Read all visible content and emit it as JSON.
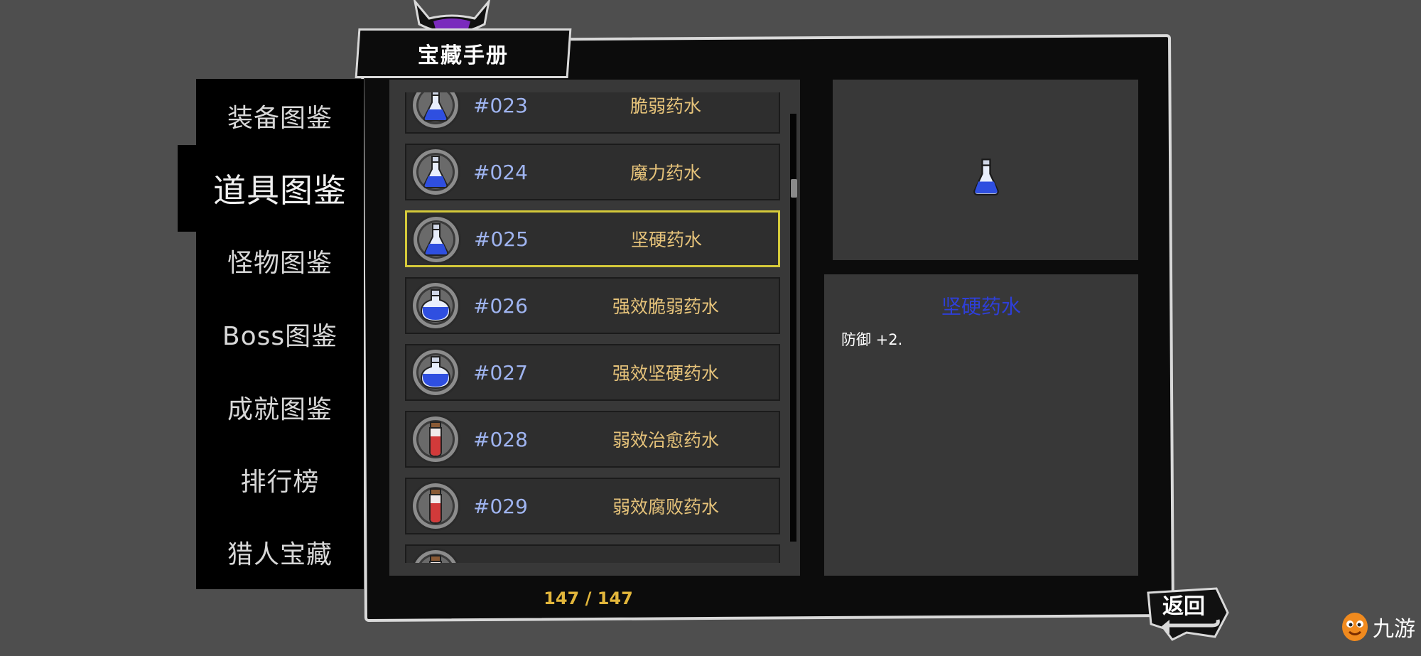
{
  "title": "宝藏手册",
  "nav": {
    "items": [
      {
        "label": "装备图鉴",
        "active": false
      },
      {
        "label": "道具图鉴",
        "active": true
      },
      {
        "label": "怪物图鉴",
        "active": false
      },
      {
        "label": "Boss图鉴",
        "active": false
      },
      {
        "label": "成就图鉴",
        "active": false
      },
      {
        "label": "排行榜",
        "active": false
      },
      {
        "label": "猎人宝藏",
        "active": false
      }
    ]
  },
  "list": {
    "items": [
      {
        "number": "#023",
        "name": "脆弱药水",
        "icon": "blue-flask-icon",
        "selected": false
      },
      {
        "number": "#024",
        "name": "魔力药水",
        "icon": "blue-flask-icon",
        "selected": false
      },
      {
        "number": "#025",
        "name": "坚硬药水",
        "icon": "blue-flask-icon",
        "selected": true
      },
      {
        "number": "#026",
        "name": "强效脆弱药水",
        "icon": "blue-bottle-icon",
        "selected": false
      },
      {
        "number": "#027",
        "name": "强效坚硬药水",
        "icon": "blue-bottle-icon",
        "selected": false
      },
      {
        "number": "#028",
        "name": "弱效治愈药水",
        "icon": "red-vial-icon",
        "selected": false
      },
      {
        "number": "#029",
        "name": "弱效腐败药水",
        "icon": "red-vial-icon",
        "selected": false
      },
      {
        "number": "",
        "name": "",
        "icon": "red-vial-icon",
        "selected": false
      }
    ],
    "counter": "147 / 147"
  },
  "detail": {
    "icon": "blue-flask-icon",
    "name": "坚硬药水",
    "description": "防御 +2."
  },
  "back_label": "返回",
  "watermark": {
    "text": "九游",
    "icon": "mascot-logo-icon"
  },
  "colors": {
    "number": "#9fb4f0",
    "name": "#e6c37a",
    "selected_border": "#d4c93a",
    "detail_title": "#2e3fd9",
    "counter": "#e2b63b"
  }
}
